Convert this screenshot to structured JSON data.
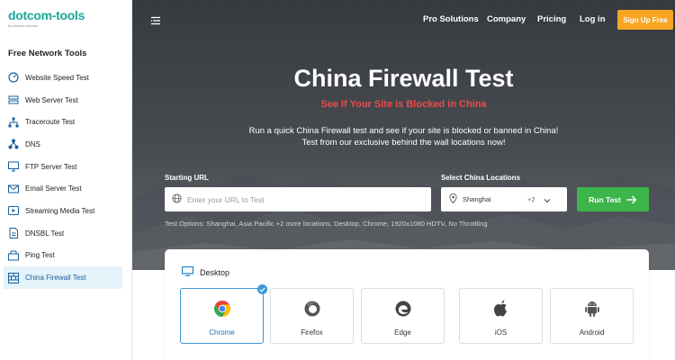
{
  "brand": {
    "name": "dotcom-tools",
    "tagline": "by dotcom-monitor"
  },
  "sidebar": {
    "title": "Free Network Tools",
    "items": [
      {
        "label": "Website Speed Test",
        "icon": "speedometer-icon"
      },
      {
        "label": "Web Server Test",
        "icon": "server-icon"
      },
      {
        "label": "Traceroute Test",
        "icon": "network-tree-icon"
      },
      {
        "label": "DNS",
        "icon": "dns-icon"
      },
      {
        "label": "FTP Server Test",
        "icon": "monitor-icon"
      },
      {
        "label": "Email Server Test",
        "icon": "email-icon"
      },
      {
        "label": "Streaming Media Test",
        "icon": "play-icon"
      },
      {
        "label": "DNSBL Test",
        "icon": "document-icon"
      },
      {
        "label": "Ping Test",
        "icon": "ping-icon"
      },
      {
        "label": "China Firewall Test",
        "icon": "firewall-icon",
        "active": true
      }
    ]
  },
  "nav": {
    "links": [
      "Pro Solutions",
      "Company",
      "Pricing",
      "Log in"
    ],
    "signup": "Sign Up Free"
  },
  "hero": {
    "title": "China Firewall Test",
    "subtitle": "See If Your Site is Blocked in China",
    "desc_line1": "Run a quick China Firewall test and see if your site is blocked or banned in China!",
    "desc_line2": "Test from our exclusive behind the wall locations now!"
  },
  "form": {
    "url_label": "Starting URL",
    "url_placeholder": "Enter your URL to Test",
    "url_value": "",
    "loc_label": "Select China Locations",
    "loc_value": "Shanghai",
    "loc_count": "+2",
    "run_label": "Run Test",
    "test_options": "Test Options: Shanghai, Asia Pacific +2 more locations, Desktop, Chrome, 1920x1080 HDTV, No Throttling"
  },
  "card": {
    "title": "Desktop",
    "browsers": [
      {
        "label": "Chrome",
        "selected": true
      },
      {
        "label": "Firefox",
        "selected": false
      },
      {
        "label": "Edge",
        "selected": false
      },
      {
        "label": "iOS",
        "selected": false
      },
      {
        "label": "Android",
        "selected": false
      }
    ]
  },
  "colors": {
    "accent_teal": "#1aa89a",
    "signup_orange": "#f6a623",
    "run_green": "#3cb54a",
    "subtitle_red": "#ef4a4a",
    "selected_blue": "#3a9ad9",
    "active_bg": "#e5f3fa"
  }
}
